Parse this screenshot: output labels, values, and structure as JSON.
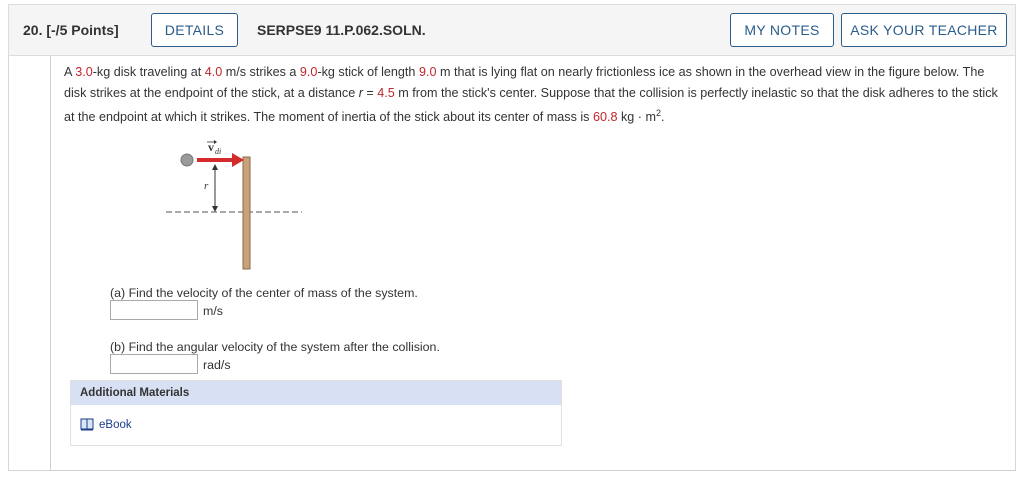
{
  "header": {
    "question_number": "20.",
    "points": "[-/5 Points]",
    "details_label": "DETAILS",
    "code": "SERPSE9 11.P.062.SOLN.",
    "my_notes_label": "MY NOTES",
    "ask_teacher_label": "ASK YOUR TEACHER"
  },
  "problem": {
    "t1": "A ",
    "mass_disk": "3.0",
    "t2": "-kg disk traveling at ",
    "speed": "4.0",
    "t3": " m/s strikes a ",
    "mass_stick": "9.0",
    "t4": "-kg stick of length ",
    "length": "9.0",
    "t5": " m that is lying flat on nearly frictionless ice as shown in the overhead view in the figure below. The disk strikes at the endpoint of the stick, at a distance ",
    "r_symbol": "r",
    "t6": " = ",
    "distance": "4.5",
    "t7": " m from the stick's center. Suppose that the collision is perfectly inelastic so that the disk adheres to the stick at the endpoint at which it strikes. The moment of inertia of the stick about its center of mass is ",
    "inertia": "60.8",
    "t8": " kg · m",
    "t9": "2",
    "t10": "."
  },
  "figure": {
    "velocity_label": "v",
    "velocity_subscript": "di",
    "r_label": "r",
    "colors": {
      "arrow": "#d42c2c",
      "stick": "#c8a27a",
      "stick_border": "#8a6a45",
      "disk": "#9a9a9a"
    }
  },
  "parts": {
    "a": {
      "prompt": "(a) Find the velocity of the center of mass of the system.",
      "value": "",
      "unit": "m/s"
    },
    "b": {
      "prompt": "(b) Find the angular velocity of the system after the collision.",
      "value": "",
      "unit": "rad/s"
    }
  },
  "additional_materials": {
    "heading": "Additional Materials",
    "ebook_label": "eBook"
  }
}
